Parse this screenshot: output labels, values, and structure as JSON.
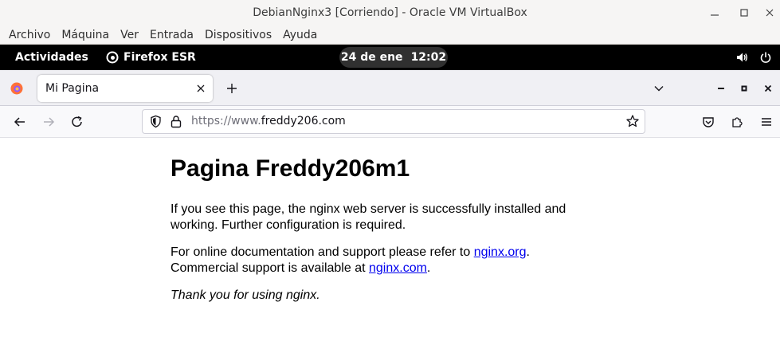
{
  "window": {
    "title": "DebianNginx3 [Corriendo] - Oracle VM VirtualBox"
  },
  "vbox_menu": [
    "Archivo",
    "Máquina",
    "Ver",
    "Entrada",
    "Dispositivos",
    "Ayuda"
  ],
  "gnome": {
    "activities": "Actividades",
    "app_name": "Firefox ESR",
    "date": "24 de ene",
    "time": "12:02"
  },
  "browser": {
    "tab_title": "Mi Pagina",
    "url_protocol": "https://www.",
    "url_host": "freddy206.com"
  },
  "page": {
    "heading": "Pagina Freddy206m1",
    "para1": "If you see this page, the nginx web server is successfully installed and working. Further configuration is required.",
    "para2_prefix": "For online documentation and support please refer to ",
    "link1": "nginx.org",
    "para2_middle": ".",
    "para2_line2": "Commercial support is available at ",
    "link2": "nginx.com",
    "para2_suffix": ".",
    "para3": "Thank you for using nginx."
  },
  "colors": {
    "gnome_bar": "#000000",
    "link": "#0000ee",
    "tab_strip": "#f0f0f4"
  }
}
